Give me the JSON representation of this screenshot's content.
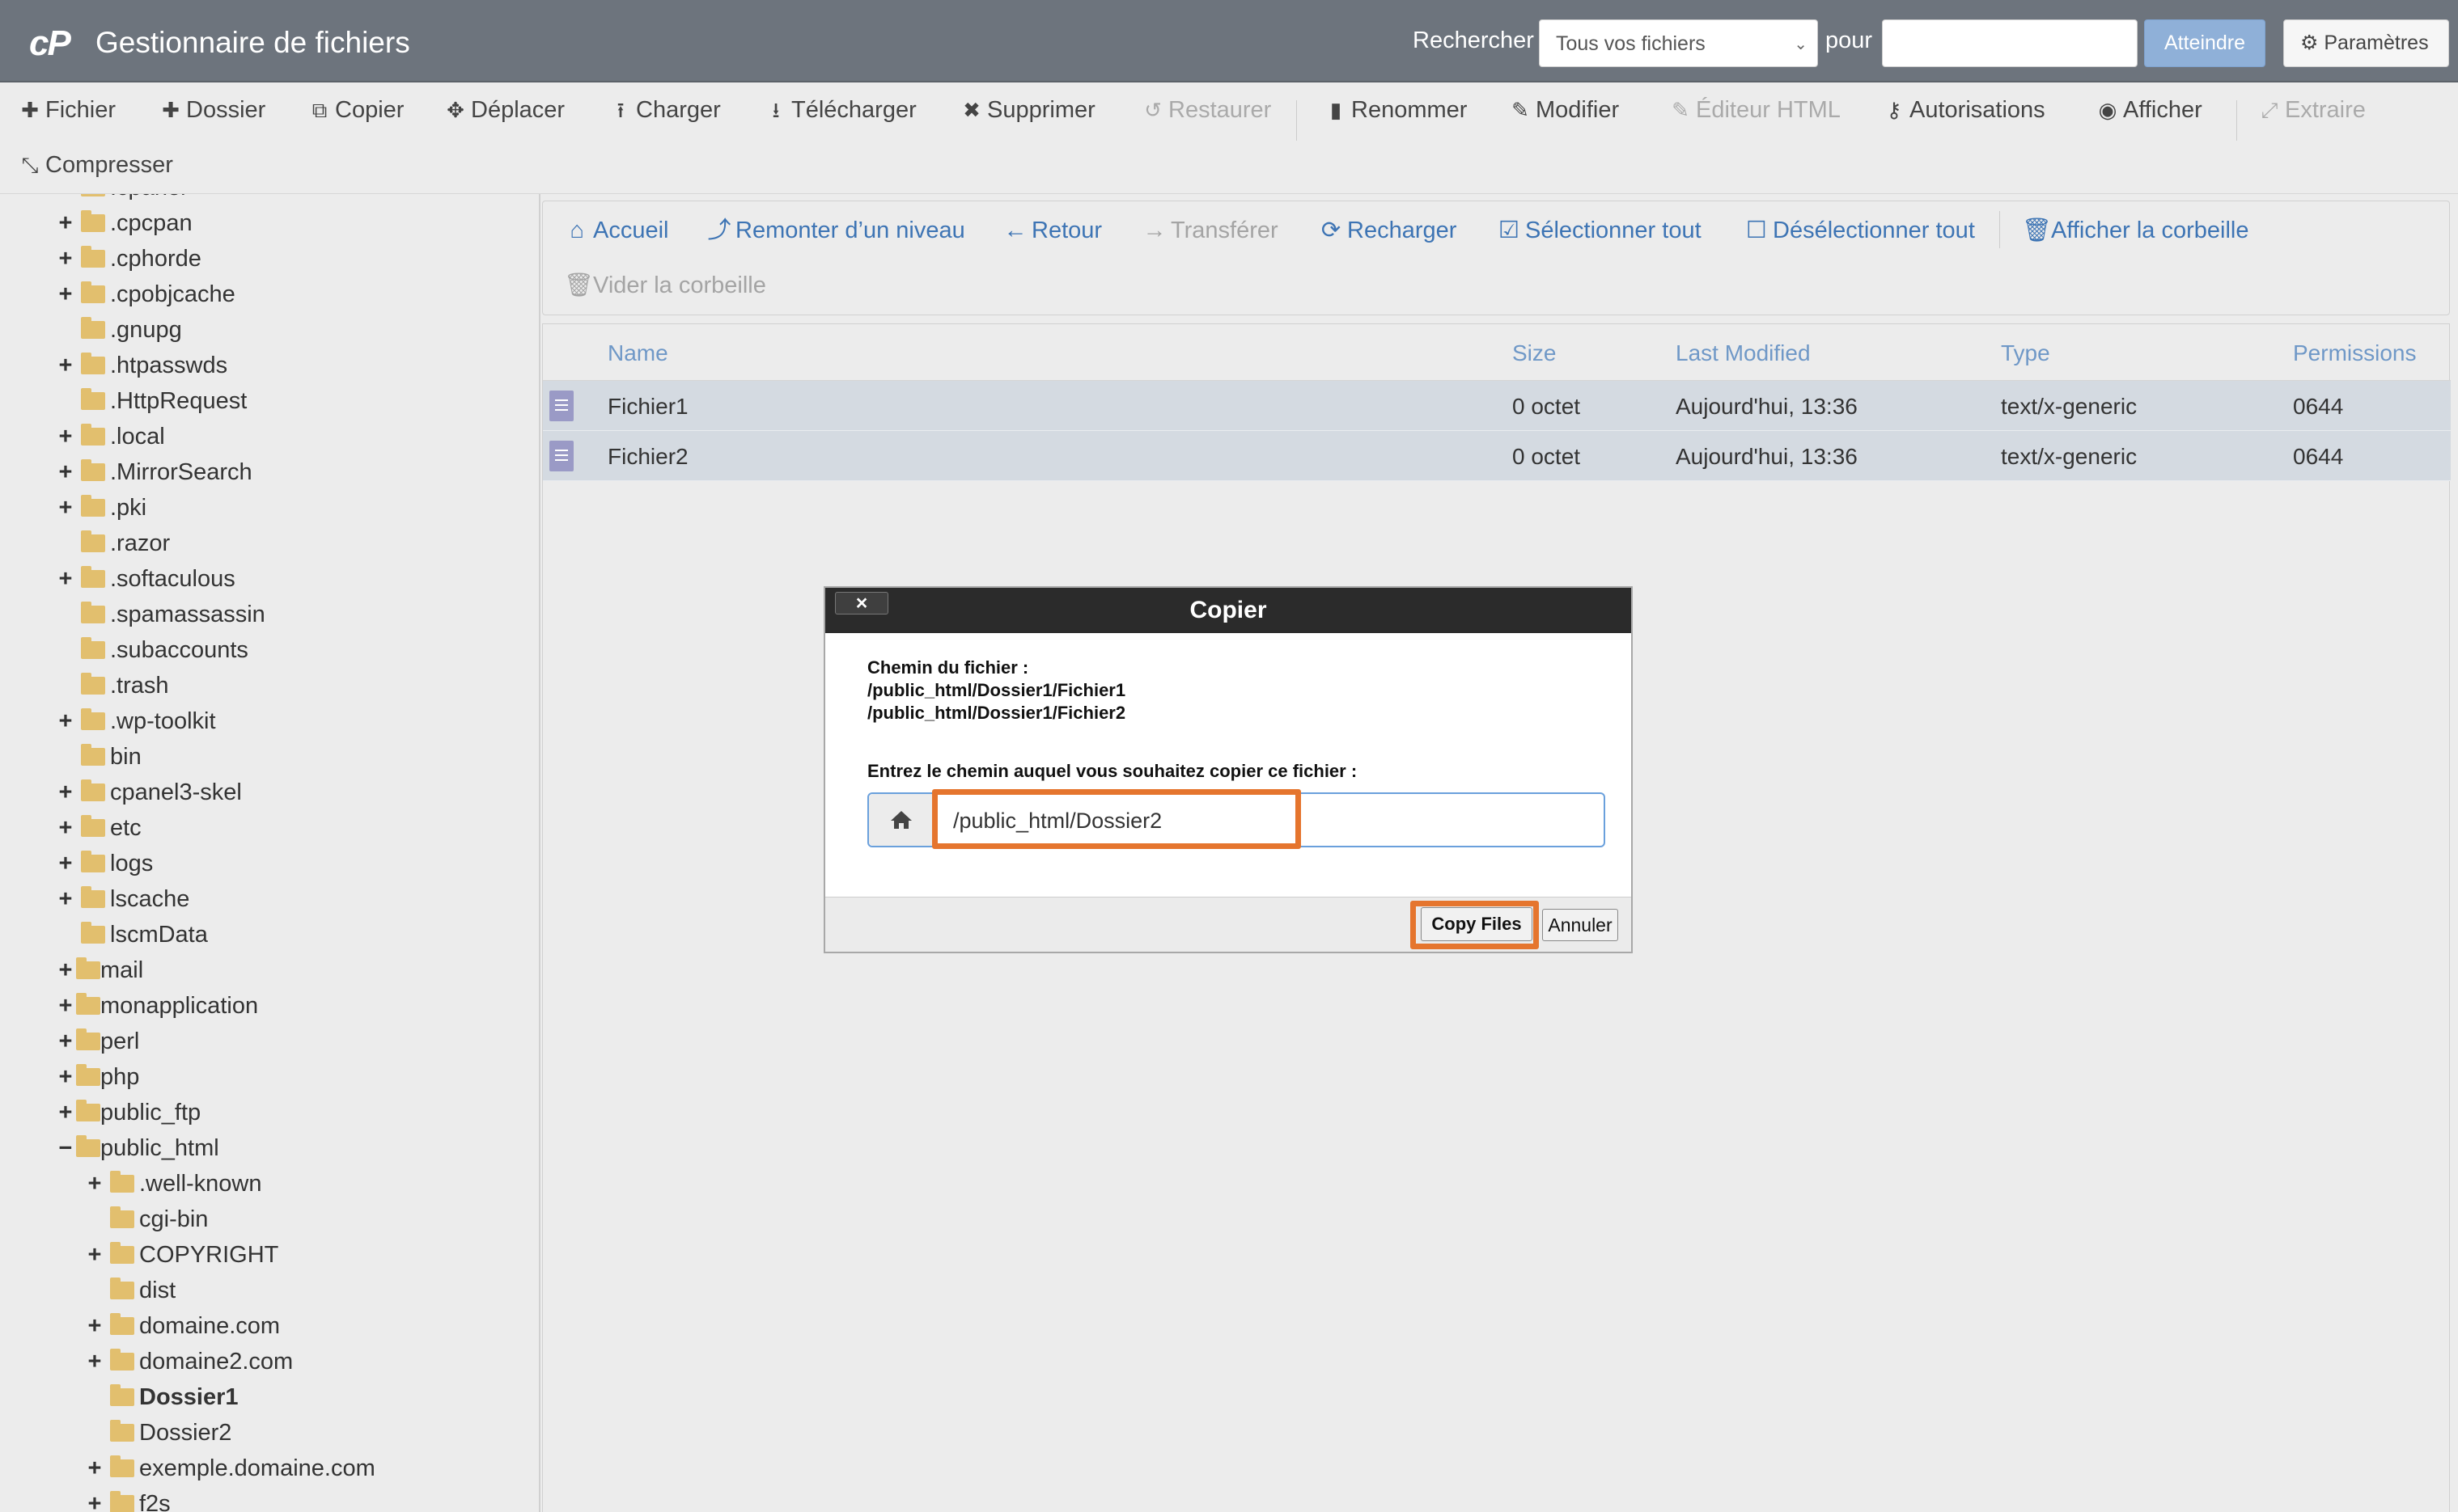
{
  "header": {
    "logo": "cP",
    "title": "Gestionnaire de fichiers",
    "search_label": "Rechercher",
    "search_scope": "Tous vos fichiers",
    "pour_label": "pour",
    "go_label": "Atteindre",
    "settings_label": "Paramètres"
  },
  "toolbar": {
    "fichier": "Fichier",
    "dossier": "Dossier",
    "copier": "Copier",
    "deplacer": "Déplacer",
    "charger": "Charger",
    "telecharger": "Télécharger",
    "supprimer": "Supprimer",
    "restaurer": "Restaurer",
    "renommer": "Renommer",
    "modifier": "Modifier",
    "editeur_html": "Éditeur HTML",
    "autorisations": "Autorisations",
    "afficher": "Afficher",
    "extraire": "Extraire",
    "compresser": "Compresser"
  },
  "tree": {
    "items": [
      {
        "label": ".cpanel",
        "toggle": "+"
      },
      {
        "label": ".cpcpan",
        "toggle": "+"
      },
      {
        "label": ".cphorde",
        "toggle": "+"
      },
      {
        "label": ".cpobjcache",
        "toggle": "+"
      },
      {
        "label": ".gnupg",
        "toggle": ""
      },
      {
        "label": ".htpasswds",
        "toggle": "+"
      },
      {
        "label": ".HttpRequest",
        "toggle": ""
      },
      {
        "label": ".local",
        "toggle": "+"
      },
      {
        "label": ".MirrorSearch",
        "toggle": "+"
      },
      {
        "label": ".pki",
        "toggle": "+"
      },
      {
        "label": ".razor",
        "toggle": ""
      },
      {
        "label": ".softaculous",
        "toggle": "+"
      },
      {
        "label": ".spamassassin",
        "toggle": ""
      },
      {
        "label": ".subaccounts",
        "toggle": ""
      },
      {
        "label": ".trash",
        "toggle": ""
      },
      {
        "label": ".wp-toolkit",
        "toggle": "+"
      },
      {
        "label": "bin",
        "toggle": ""
      },
      {
        "label": "cpanel3-skel",
        "toggle": "+"
      },
      {
        "label": "etc",
        "toggle": "+"
      },
      {
        "label": "logs",
        "toggle": "+"
      },
      {
        "label": "lscache",
        "toggle": "+"
      },
      {
        "label": "lscmData",
        "toggle": ""
      },
      {
        "label": "mail",
        "toggle": "+"
      },
      {
        "label": "monapplication",
        "toggle": "+"
      },
      {
        "label": "perl",
        "toggle": "+"
      },
      {
        "label": "php",
        "toggle": "+"
      },
      {
        "label": "public_ftp",
        "toggle": "+"
      },
      {
        "label": "public_html",
        "toggle": "−"
      },
      {
        "label": ".well-known",
        "toggle": "+"
      },
      {
        "label": "cgi-bin",
        "toggle": ""
      },
      {
        "label": "COPYRIGHT",
        "toggle": "+"
      },
      {
        "label": "dist",
        "toggle": ""
      },
      {
        "label": "domaine.com",
        "toggle": "+"
      },
      {
        "label": "domaine2.com",
        "toggle": "+"
      },
      {
        "label": "Dossier1",
        "toggle": ""
      },
      {
        "label": "Dossier2",
        "toggle": ""
      },
      {
        "label": "exemple.domaine.com",
        "toggle": "+"
      },
      {
        "label": "f2s",
        "toggle": "+"
      }
    ]
  },
  "nav": {
    "accueil": "Accueil",
    "remonter": "Remonter d’un niveau",
    "retour": "Retour",
    "transferer": "Transférer",
    "recharger": "Recharger",
    "select_all": "Sélectionner tout",
    "deselect_all": "Désélectionner tout",
    "show_trash": "Afficher la corbeille",
    "empty_trash": "Vider la corbeille"
  },
  "table": {
    "headers": [
      "Name",
      "Size",
      "Last Modified",
      "Type",
      "Permissions"
    ],
    "rows": [
      {
        "name": "Fichier1",
        "size": "0 octet",
        "modified": "Aujourd'hui, 13:36",
        "type": "text/x-generic",
        "perms": "0644"
      },
      {
        "name": "Fichier2",
        "size": "0 octet",
        "modified": "Aujourd'hui, 13:36",
        "type": "text/x-generic",
        "perms": "0644"
      }
    ]
  },
  "dialog": {
    "title": "Copier",
    "close": "×",
    "path_label": "Chemin du fichier :",
    "paths": [
      "/public_html/Dossier1/Fichier1",
      "/public_html/Dossier1/Fichier2"
    ],
    "prompt": "Entrez le chemin auquel vous souhaitez copier ce fichier :",
    "destination": "/public_html/Dossier2",
    "copy_label": "Copy Files",
    "cancel_label": "Annuler"
  },
  "colors": {
    "highlight": "#e5752e",
    "link": "#3d74b4",
    "header_bg": "#6d747d"
  }
}
